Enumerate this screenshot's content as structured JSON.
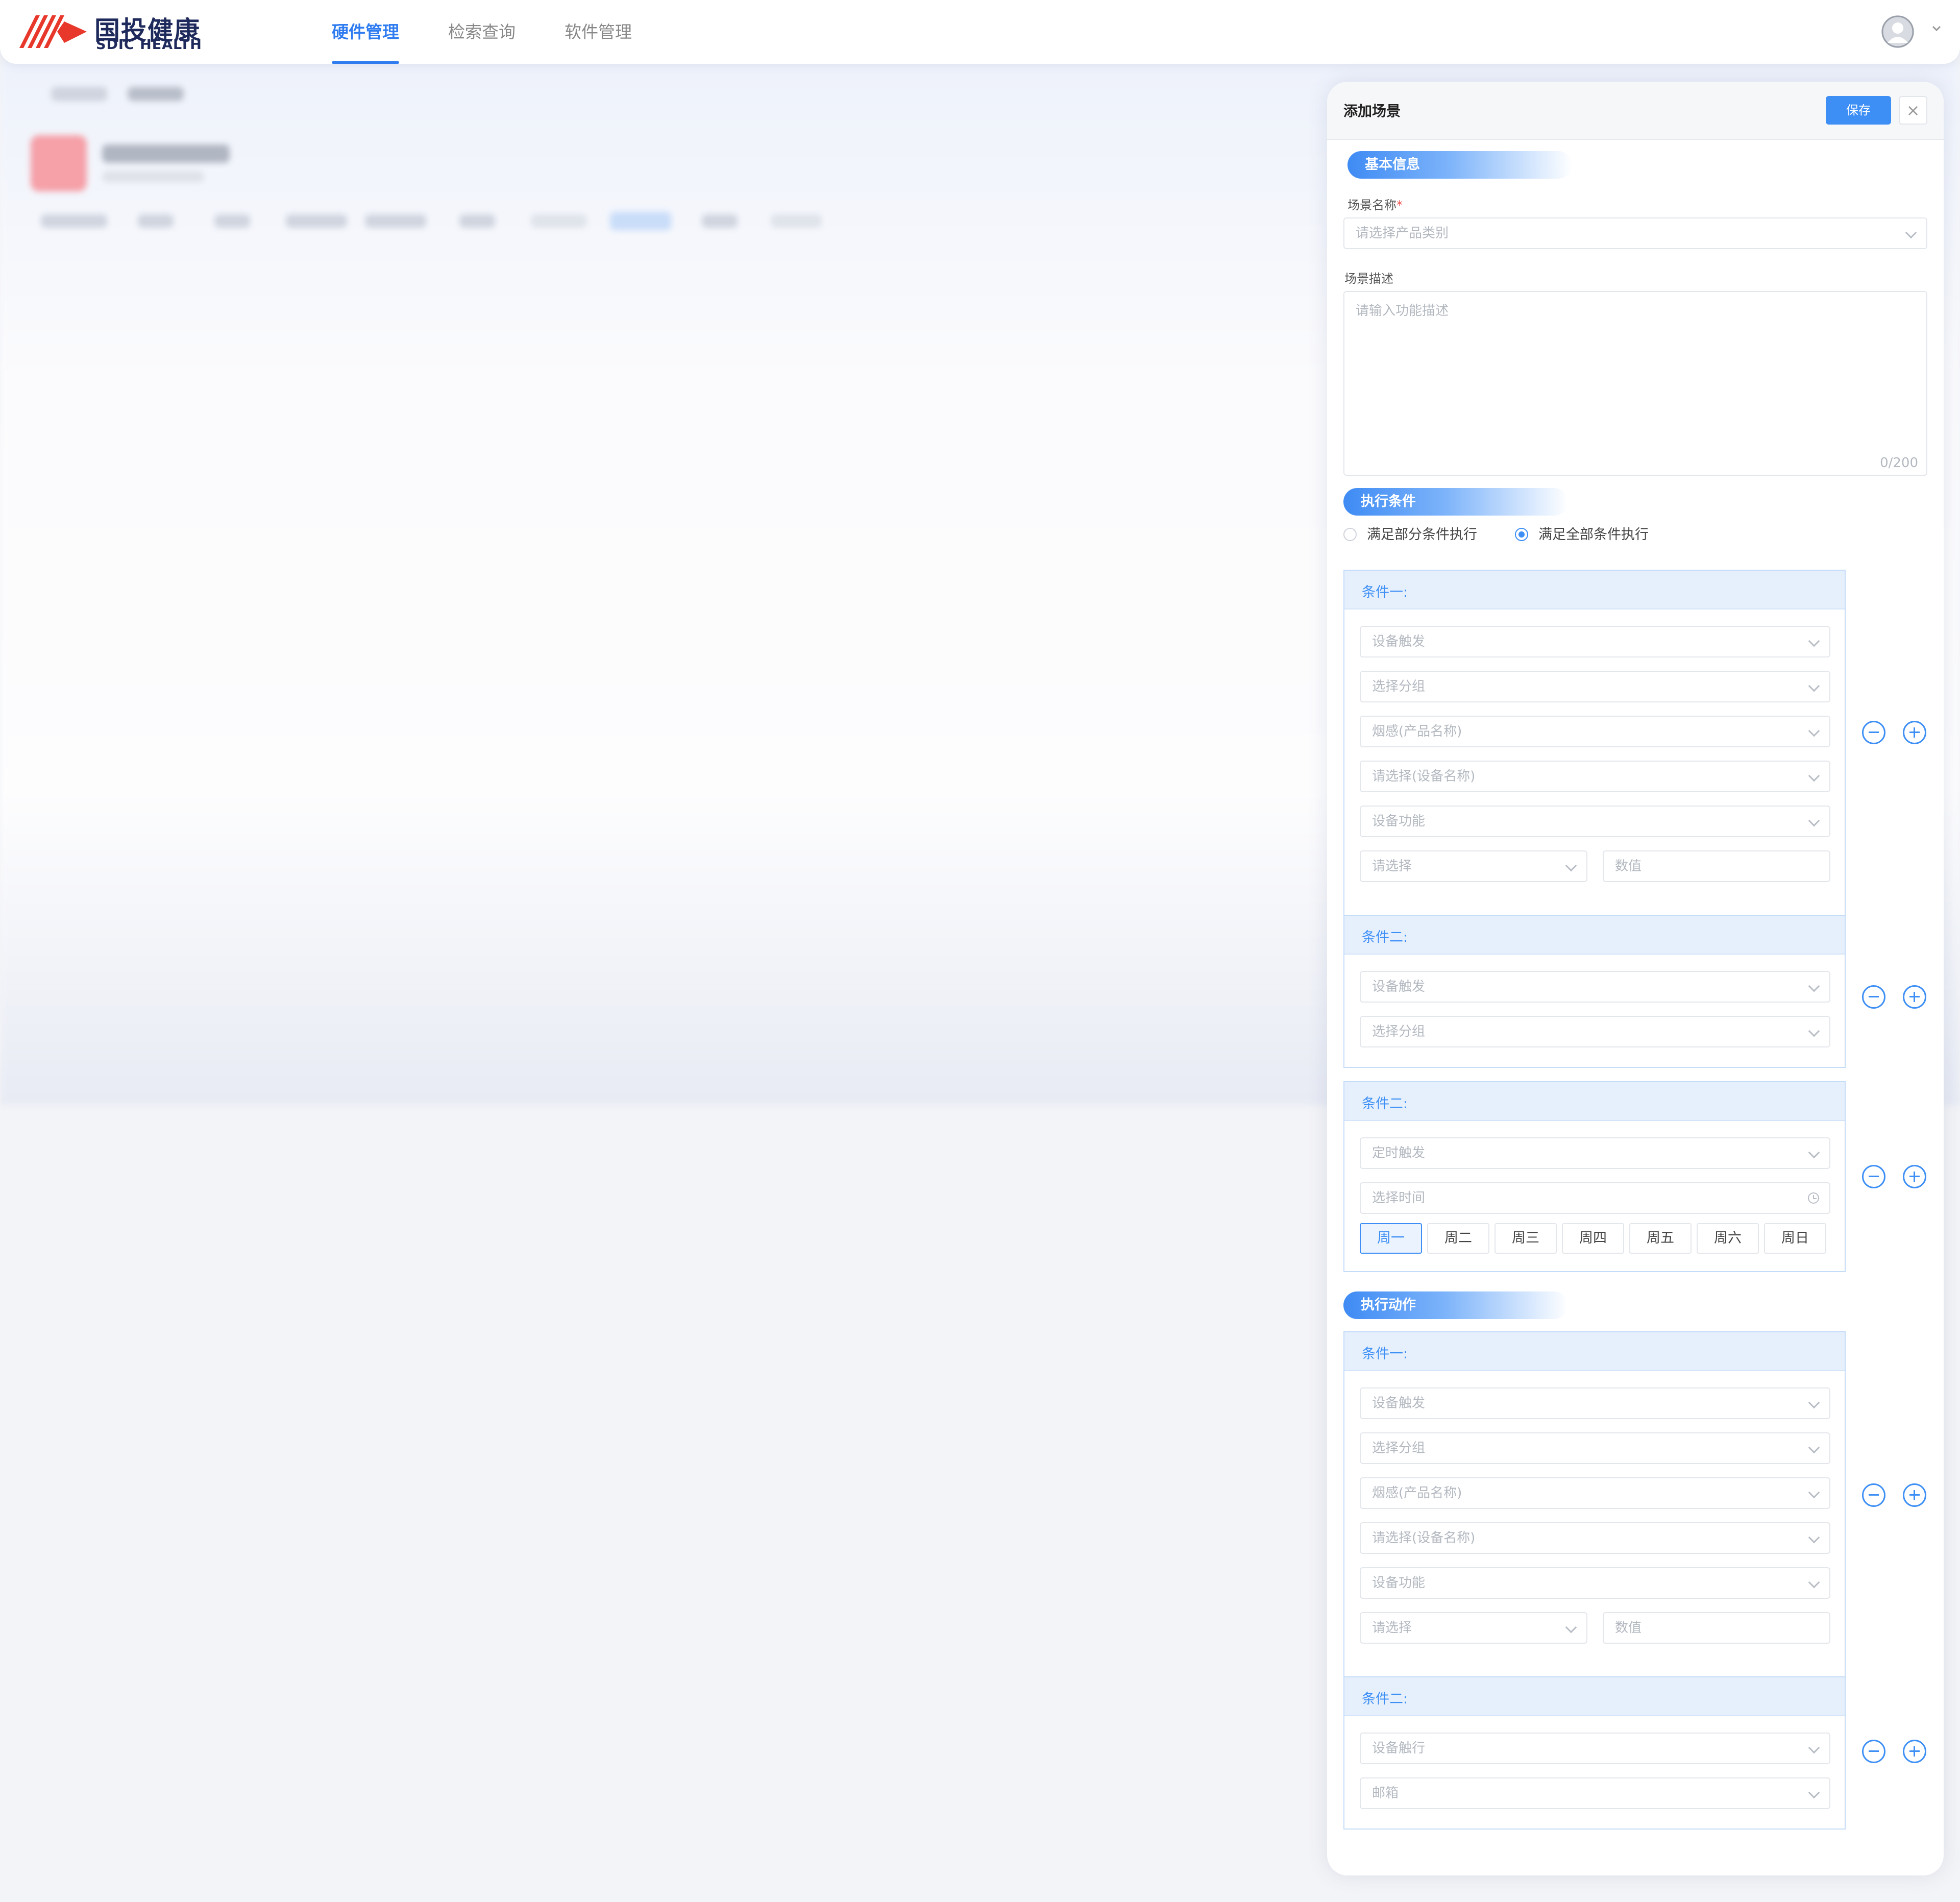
{
  "header": {
    "logo_cn": "国投健康",
    "logo_en": "SDIC HEALTH",
    "nav": [
      {
        "label": "硬件管理",
        "active": true
      },
      {
        "label": "检索查询",
        "active": false
      },
      {
        "label": "软件管理",
        "active": false
      }
    ],
    "accent_color": "#2f7cf0"
  },
  "drawer": {
    "title": "添加场景",
    "save_label": "保存",
    "close_icon": "×",
    "basic": {
      "section_label": "基本信息",
      "name_label": "场景名称",
      "name_required_mark": "*",
      "name_placeholder": "请选择产品类别",
      "desc_label": "场景描述",
      "desc_placeholder": "请输入功能描述",
      "desc_counter": "0/200"
    },
    "conditions": {
      "section_label": "执行条件",
      "radio_partial": "满足部分条件执行",
      "radio_all": "满足全部条件执行",
      "selected": "all",
      "cond1": {
        "title": "条件一:",
        "trigger": "设备触发",
        "group": "选择分组",
        "product": "烟感(产品名称)",
        "device": "请选择(设备名称)",
        "function": "设备功能",
        "operator": "请选择",
        "value": "数值"
      },
      "cond2": {
        "title": "条件二:",
        "trigger": "设备触发",
        "group": "选择分组"
      },
      "cond3": {
        "title": "条件二:",
        "trigger": "定时触发",
        "time": "选择时间",
        "days": [
          "周一",
          "周二",
          "周三",
          "周四",
          "周五",
          "周六",
          "周日"
        ],
        "selected_day": "周一"
      }
    },
    "actions": {
      "section_label": "执行动作",
      "act1": {
        "title": "条件一:",
        "trigger": "设备触发",
        "group": "选择分组",
        "product": "烟感(产品名称)",
        "device": "请选择(设备名称)",
        "function": "设备功能",
        "operator": "请选择",
        "value": "数值"
      },
      "act2": {
        "title": "条件二:",
        "trigger": "设备触行",
        "target": "邮箱"
      }
    }
  }
}
